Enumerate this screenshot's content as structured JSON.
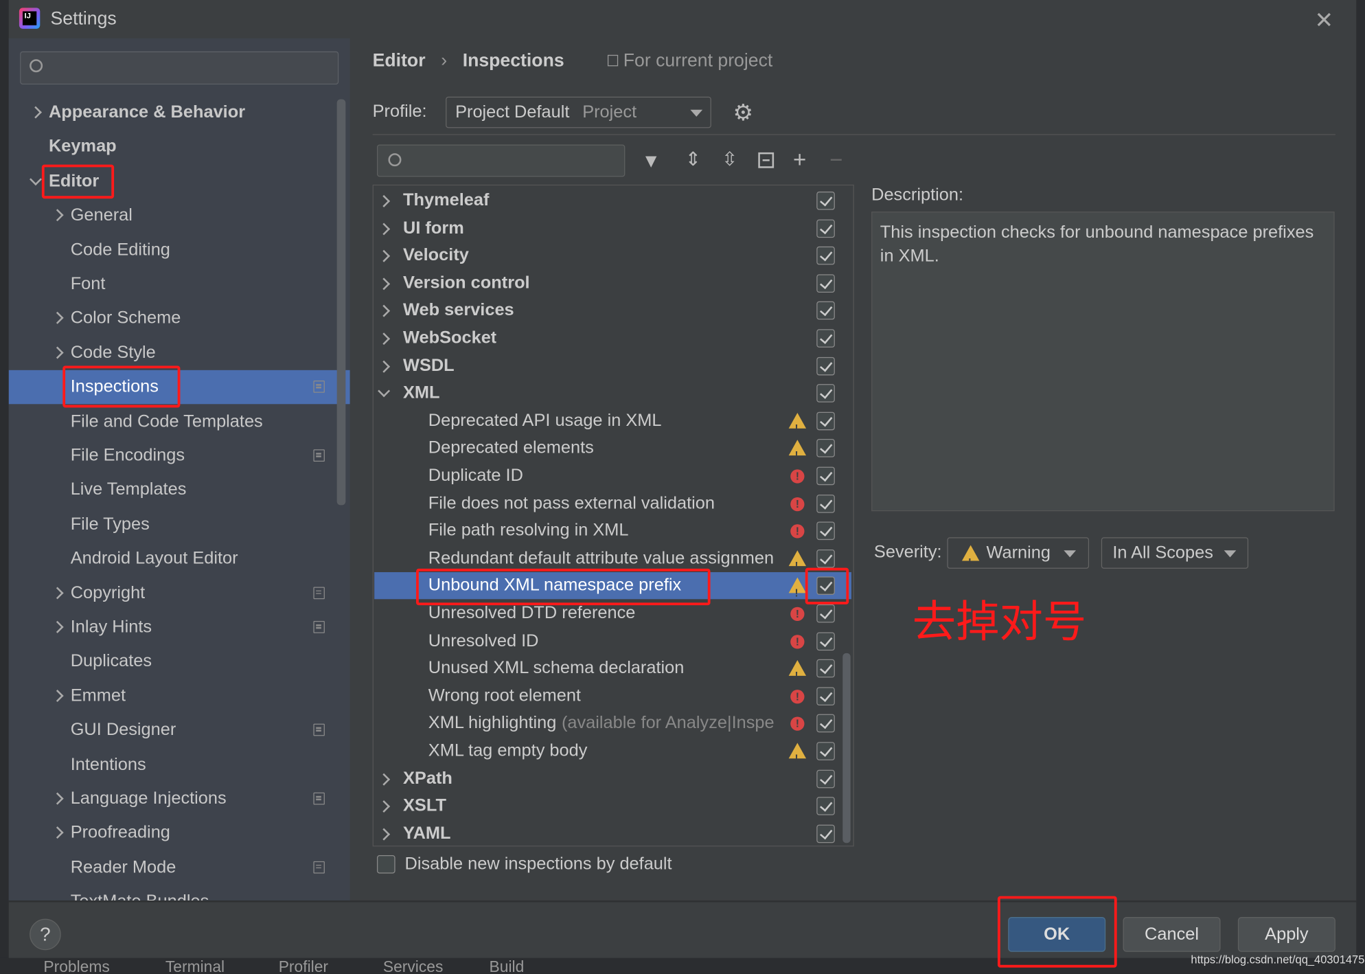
{
  "window": {
    "title": "Settings"
  },
  "sidebar": {
    "search_placeholder": "",
    "items": [
      {
        "label": "Appearance & Behavior",
        "level": 0,
        "bold": true,
        "expander": "collapsed"
      },
      {
        "label": "Keymap",
        "level": 0,
        "bold": true
      },
      {
        "label": "Editor",
        "level": 0,
        "bold": true,
        "expander": "expanded",
        "highlighted": true
      },
      {
        "label": "General",
        "level": 1,
        "expander": "collapsed"
      },
      {
        "label": "Code Editing",
        "level": 1
      },
      {
        "label": "Font",
        "level": 1
      },
      {
        "label": "Color Scheme",
        "level": 1,
        "expander": "collapsed"
      },
      {
        "label": "Code Style",
        "level": 1,
        "expander": "collapsed"
      },
      {
        "label": "Inspections",
        "level": 1,
        "selected": true,
        "project": true,
        "highlighted": true
      },
      {
        "label": "File and Code Templates",
        "level": 1
      },
      {
        "label": "File Encodings",
        "level": 1,
        "project": true
      },
      {
        "label": "Live Templates",
        "level": 1
      },
      {
        "label": "File Types",
        "level": 1
      },
      {
        "label": "Android Layout Editor",
        "level": 1
      },
      {
        "label": "Copyright",
        "level": 1,
        "expander": "collapsed",
        "project": true
      },
      {
        "label": "Inlay Hints",
        "level": 1,
        "expander": "collapsed",
        "project": true
      },
      {
        "label": "Duplicates",
        "level": 1
      },
      {
        "label": "Emmet",
        "level": 1,
        "expander": "collapsed"
      },
      {
        "label": "GUI Designer",
        "level": 1,
        "project": true
      },
      {
        "label": "Intentions",
        "level": 1
      },
      {
        "label": "Language Injections",
        "level": 1,
        "expander": "collapsed",
        "project": true
      },
      {
        "label": "Proofreading",
        "level": 1,
        "expander": "collapsed"
      },
      {
        "label": "Reader Mode",
        "level": 1,
        "project": true
      },
      {
        "label": "TextMate Bundles",
        "level": 1
      }
    ]
  },
  "header": {
    "breadcrumb": [
      "Editor",
      "Inspections"
    ],
    "scope_note": "For current project"
  },
  "profile": {
    "label": "Profile:",
    "value": "Project Default",
    "scope": "Project"
  },
  "tree": {
    "search_placeholder": "",
    "rows": [
      {
        "label": "Thymeleaf",
        "group": true,
        "expander": "collapsed",
        "checked": true
      },
      {
        "label": "UI form",
        "group": true,
        "expander": "collapsed",
        "checked": true
      },
      {
        "label": "Velocity",
        "group": true,
        "expander": "collapsed",
        "checked": true
      },
      {
        "label": "Version control",
        "group": true,
        "expander": "collapsed",
        "checked": true
      },
      {
        "label": "Web services",
        "group": true,
        "expander": "collapsed",
        "checked": true
      },
      {
        "label": "WebSocket",
        "group": true,
        "expander": "collapsed",
        "checked": true
      },
      {
        "label": "WSDL",
        "group": true,
        "expander": "collapsed",
        "checked": true
      },
      {
        "label": "XML",
        "group": true,
        "expander": "expanded",
        "checked": true
      },
      {
        "label": "Deprecated API usage in XML",
        "severity": "warning",
        "checked": true
      },
      {
        "label": "Deprecated elements",
        "severity": "warning",
        "checked": true
      },
      {
        "label": "Duplicate ID",
        "severity": "error",
        "checked": true
      },
      {
        "label": "File does not pass external validation",
        "severity": "error",
        "checked": true
      },
      {
        "label": "File path resolving in XML",
        "severity": "error",
        "checked": true
      },
      {
        "label": "Redundant default attribute value assignmen",
        "severity": "warning",
        "checked": true
      },
      {
        "label": "Unbound XML namespace prefix",
        "severity": "warning",
        "checked": true,
        "selected": true
      },
      {
        "label": "Unresolved DTD reference",
        "severity": "error",
        "checked": true
      },
      {
        "label": "Unresolved ID",
        "severity": "error",
        "checked": true
      },
      {
        "label": "Unused XML schema declaration",
        "severity": "warning",
        "checked": true
      },
      {
        "label": "Wrong root element",
        "severity": "error",
        "checked": true
      },
      {
        "label": "XML highlighting",
        "note": "(available for Analyze|Inspe",
        "severity": "error",
        "checked": true
      },
      {
        "label": "XML tag empty body",
        "severity": "warning",
        "checked": true
      },
      {
        "label": "XPath",
        "group": true,
        "expander": "collapsed",
        "checked": true
      },
      {
        "label": "XSLT",
        "group": true,
        "expander": "collapsed",
        "checked": true
      },
      {
        "label": "YAML",
        "group": true,
        "expander": "collapsed",
        "checked": true
      }
    ]
  },
  "disable_new": {
    "label": "Disable new inspections by default",
    "checked": false
  },
  "description": {
    "label": "Description:",
    "text": "This inspection checks for unbound namespace prefixes in XML."
  },
  "severity": {
    "label": "Severity:",
    "value": "Warning",
    "scope": "In All Scopes"
  },
  "annotation": {
    "text": "去掉对号",
    "color": "#ff1a1a"
  },
  "buttons": {
    "ok": "OK",
    "cancel": "Cancel",
    "apply": "Apply",
    "help": "?"
  },
  "taskbar": [
    "Problems",
    "Terminal",
    "Profiler",
    "Services",
    "Build"
  ],
  "watermark": "https://blog.csdn.net/qq_40301475",
  "colors": {
    "selection": "#4b6eaf",
    "background": "#3c3f41",
    "sidebar": "#3e434c",
    "highlight_box": "#ff1a1a"
  }
}
